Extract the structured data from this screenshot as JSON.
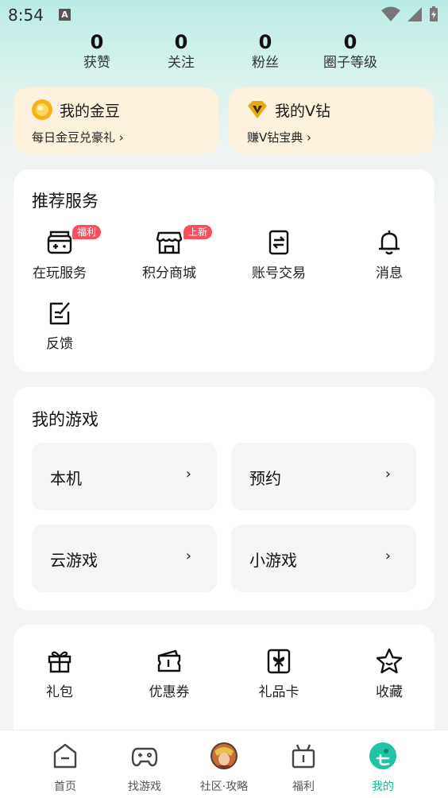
{
  "status": {
    "time": "8:54",
    "notif_letter": "A"
  },
  "stats": [
    {
      "value": "0",
      "label": "获赞"
    },
    {
      "value": "0",
      "label": "关注"
    },
    {
      "value": "0",
      "label": "粉丝"
    },
    {
      "value": "0",
      "label": "圈子等级"
    }
  ],
  "promos": {
    "gold": {
      "title": "我的金豆",
      "subtitle": "每日金豆兑豪礼 ›"
    },
    "vdiamond": {
      "title": "我的V钻",
      "subtitle": "赚V钻宝典 ›"
    }
  },
  "recommended": {
    "title": "推荐服务",
    "items": [
      {
        "label": "在玩服务",
        "badge": "福利"
      },
      {
        "label": "积分商城",
        "badge": "上新"
      },
      {
        "label": "账号交易"
      },
      {
        "label": "消息"
      },
      {
        "label": "反馈"
      }
    ]
  },
  "my_games": {
    "title": "我的游戏",
    "tiles": [
      "本机",
      "预约",
      "云游戏",
      "小游戏"
    ],
    "chevron": "›"
  },
  "extras": [
    "礼包",
    "优惠券",
    "礼品卡",
    "收藏"
  ],
  "tabs": [
    {
      "label": "首页",
      "icon": "home-icon"
    },
    {
      "label": "找游戏",
      "icon": "gamepad-icon"
    },
    {
      "label": "社区·攻略",
      "icon": "avatar-icon"
    },
    {
      "label": "福利",
      "icon": "gift-box-icon"
    },
    {
      "label": "我的",
      "icon": "profile-face-icon",
      "active": true
    }
  ],
  "colors": {
    "accent": "#18b89a",
    "badge": "#ff4d5b",
    "promo_bg": "#fcf1dc"
  }
}
